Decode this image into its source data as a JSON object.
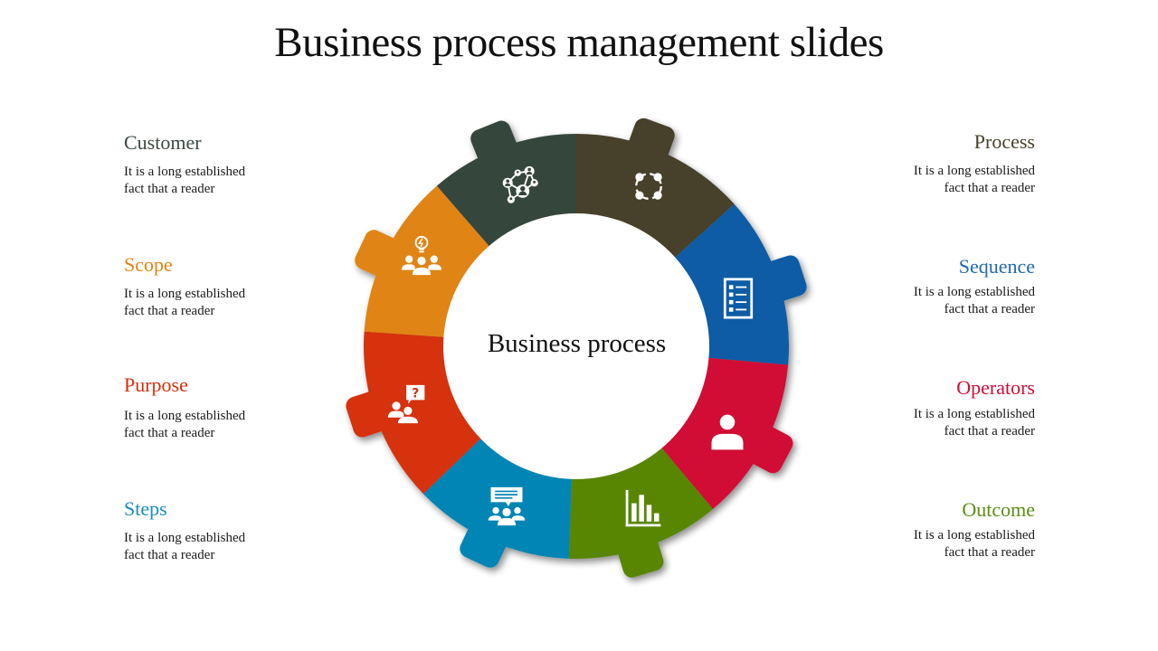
{
  "title": "Business process management slides",
  "center_label": "Business process",
  "segments": [
    {
      "key": "customer",
      "label": "Customer",
      "desc_line1": "It is a long established",
      "desc_line2": "fact that a reader",
      "color": "#34473D",
      "icon": "network-icon",
      "side": "left"
    },
    {
      "key": "process",
      "label": "Process",
      "desc_line1": "It is a long established",
      "desc_line2": "fact that a reader",
      "color": "#47402A",
      "icon": "cycle-icon",
      "side": "right"
    },
    {
      "key": "sequence",
      "label": "Sequence",
      "desc_line1": "It is a long established",
      "desc_line2": "fact that a reader",
      "color": "#0E5BA5",
      "icon": "checklist-icon",
      "side": "right"
    },
    {
      "key": "operators",
      "label": "Operators",
      "desc_line1": "It is a long established",
      "desc_line2": "fact that a reader",
      "color": "#D10D34",
      "icon": "person-icon",
      "side": "right"
    },
    {
      "key": "outcome",
      "label": "Outcome",
      "desc_line1": "It is a long established",
      "desc_line2": "fact that a reader",
      "color": "#588605",
      "icon": "bar-chart-icon",
      "side": "right"
    },
    {
      "key": "steps",
      "label": "Steps",
      "desc_line1": "It is a long established",
      "desc_line2": "fact that a reader",
      "color": "#0685B5",
      "icon": "team-discussion-icon",
      "side": "left"
    },
    {
      "key": "purpose",
      "label": "Purpose",
      "desc_line1": "It is a long established",
      "desc_line2": "fact that a reader",
      "color": "#D5300E",
      "icon": "team-question-icon",
      "side": "left"
    },
    {
      "key": "scope",
      "label": "Scope",
      "desc_line1": "It is a long established",
      "desc_line2": "fact that a reader",
      "color": "#E08414",
      "icon": "team-idea-icon",
      "side": "left"
    }
  ],
  "text_colors": {
    "customer": "#3B4A41",
    "process": "#47402A",
    "sequence": "#1F6AAE",
    "operators": "#D10D34",
    "outcome": "#5A8F12",
    "steps": "#1A8CBF",
    "purpose": "#D5300E",
    "scope": "#E08414"
  }
}
